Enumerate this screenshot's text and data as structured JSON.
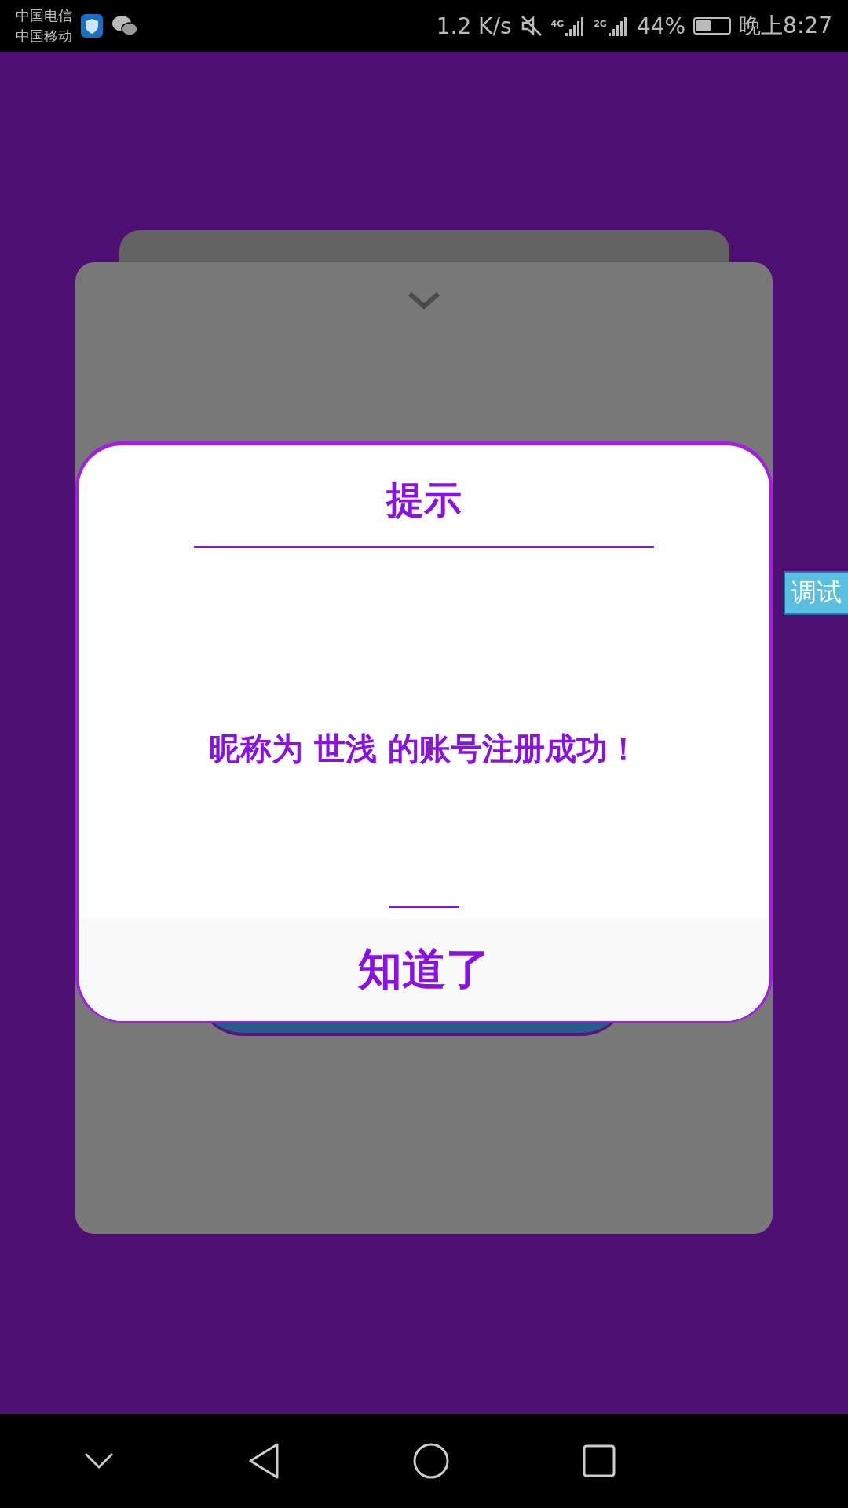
{
  "status_bar": {
    "carriers": [
      "中国电信",
      "中国移动"
    ],
    "speed": "1.2 K/s",
    "networks": [
      {
        "label": "4G"
      },
      {
        "label": "2G"
      }
    ],
    "battery": "44%",
    "battery_meter": {
      "level": 0.44
    },
    "time": "晚上8:27"
  },
  "dialog": {
    "title": "提示",
    "message": "昵称为 世浅 的账号注册成功！",
    "button": "知道了"
  },
  "debug_tab": "调试"
}
